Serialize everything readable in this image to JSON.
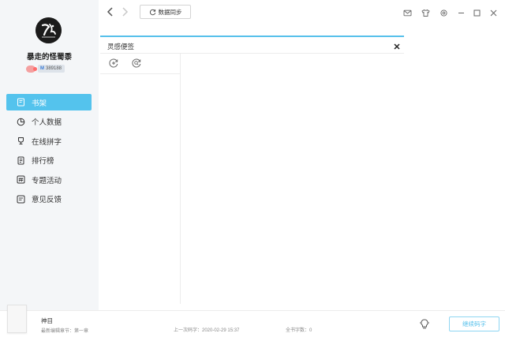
{
  "sidebar": {
    "username": "暴走的怪蜀黍",
    "id_badge": "389188",
    "nav": [
      {
        "label": "书架",
        "icon": "bookshelf-icon",
        "active": true
      },
      {
        "label": "个人数据",
        "icon": "pie-chart-icon",
        "active": false
      },
      {
        "label": "在线拼字",
        "icon": "trophy-icon",
        "active": false
      },
      {
        "label": "排行榜",
        "icon": "ranking-icon",
        "active": false
      },
      {
        "label": "专题活动",
        "icon": "hashtag-icon",
        "active": false
      },
      {
        "label": "意见反馈",
        "icon": "feedback-icon",
        "active": false
      }
    ]
  },
  "topbar": {
    "sync_label": "数据同步"
  },
  "panel": {
    "title": "灵感便签"
  },
  "bottombar": {
    "book_title": "神目",
    "chapter": "最新编辑章节：第一章",
    "last_sync": "上一次码字：2020-02-29 15:37",
    "word_count": "全书字数：0",
    "continue_label": "继续码字"
  },
  "colors": {
    "accent": "#54c3ed",
    "sidebar_bg": "#f4f6f8"
  }
}
